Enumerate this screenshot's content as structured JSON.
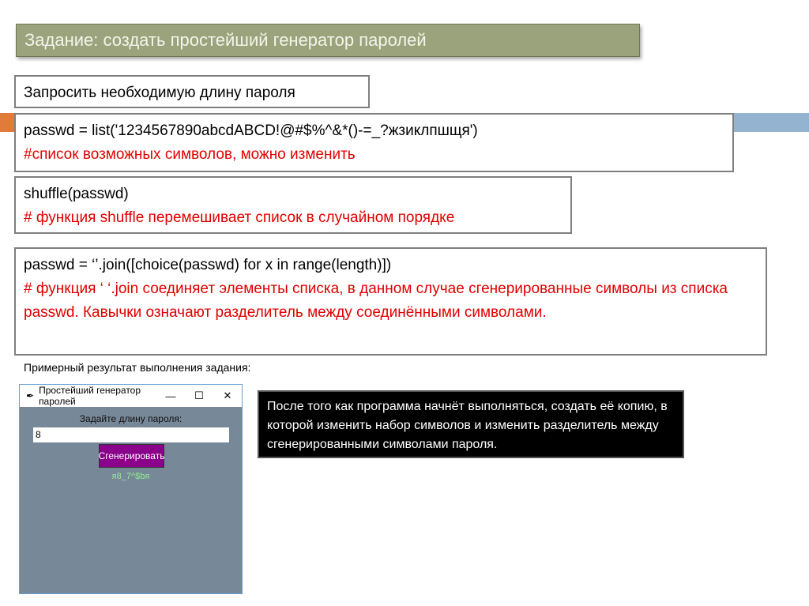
{
  "title": "Задание: создать простейший генератор паролей",
  "step1": "Запросить необходимую длину пароля",
  "step2": {
    "code": "passwd = list('1234567890abcdABCD!@#$%^&*()-=_?жзиклпшщя')",
    "comment": "#список возможных символов, можно изменить"
  },
  "step3": {
    "code": "shuffle(passwd)",
    "comment": "# функция shuffle перемешивает список в случайном порядке"
  },
  "step4": {
    "code": "passwd = ‘’.join([choice(passwd) for x in range(length)])",
    "comment": "# функция ‘ ‘.join соединяет элементы списка, в данном случае сгенерированные символы из списка passwd. Кавычки означают разделитель между соединёнными символами."
  },
  "caption": "Примерный результат выполнения задания:",
  "window": {
    "title": "Простейший генератор паролей",
    "minimize": "—",
    "maximize": "☐",
    "close": "✕",
    "label": "Задайте длину пароля:",
    "input_value": "8",
    "button": "Сгенерировать",
    "result": "я8_7^$bя"
  },
  "note": "После того как программа начнёт выполняться, создать её копию, в которой изменить набор символов и изменить разделитель между сгенерированными символами пароля."
}
